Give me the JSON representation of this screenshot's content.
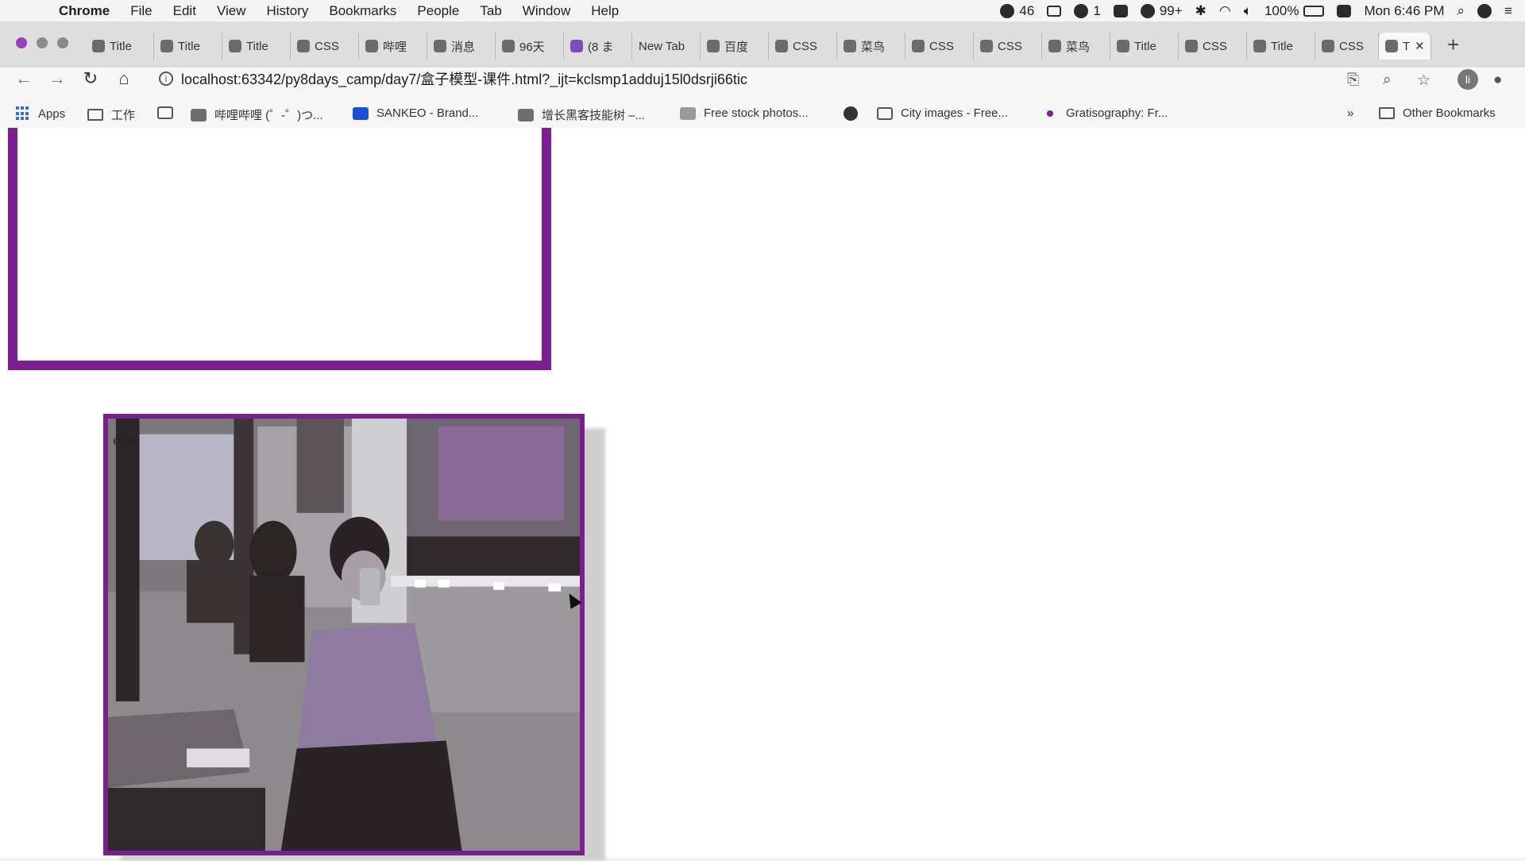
{
  "menubar": {
    "app_name": "Chrome",
    "items": [
      "File",
      "Edit",
      "View",
      "History",
      "Bookmarks",
      "People",
      "Tab",
      "Window",
      "Help"
    ],
    "status": {
      "wechat_count": "46",
      "badge_1": "1",
      "qq_count": "99+",
      "battery": "100%",
      "clock": "Mon 6:46 PM"
    }
  },
  "tabs": [
    {
      "label": "Title"
    },
    {
      "label": "Title"
    },
    {
      "label": "Title"
    },
    {
      "label": "CSS"
    },
    {
      "label": "哔哩"
    },
    {
      "label": "消息"
    },
    {
      "label": "96天"
    },
    {
      "label": "(8 ま"
    },
    {
      "label": "New Tab"
    },
    {
      "label": "百度"
    },
    {
      "label": "CSS"
    },
    {
      "label": "菜鸟"
    },
    {
      "label": "CSS"
    },
    {
      "label": "CSS"
    },
    {
      "label": "菜鸟"
    },
    {
      "label": "Title"
    },
    {
      "label": "CSS"
    },
    {
      "label": "Title"
    },
    {
      "label": "CSS"
    },
    {
      "label": "T"
    }
  ],
  "address_bar": {
    "url": "localhost:63342/py8days_camp/day7/盒子模型-课件.html?_ijt=kclsmp1adduj15l0dsrji66tic"
  },
  "profile": {
    "initial": "li"
  },
  "bookmarks": {
    "apps": "Apps",
    "items": [
      "工作",
      "哔哩哔哩 (゜-゜)つ...",
      "SANKEO - Brand...",
      "增长黑客技能树 –...",
      "Free stock photos...",
      "City images - Free...",
      "Gratisography: Fr..."
    ],
    "overflow": "»",
    "other": "Other Bookmarks"
  },
  "content": {
    "box2_text": "ello"
  },
  "colors": {
    "border_purple": "#7b1f8f",
    "page_bg": "#ffffff"
  }
}
